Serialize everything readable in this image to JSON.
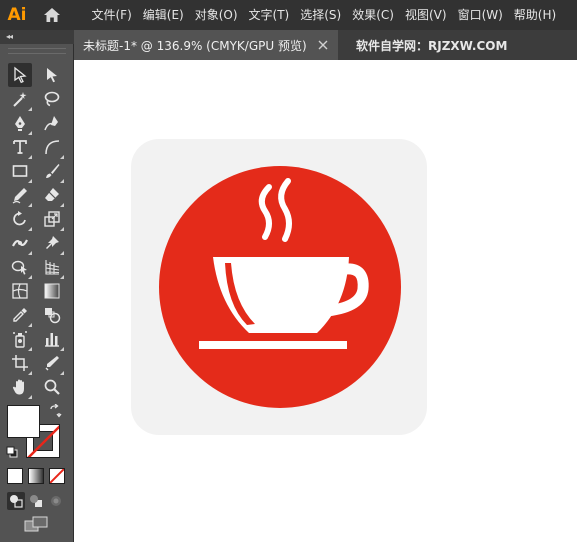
{
  "app": {
    "logo": "Ai",
    "home_icon": "home-icon"
  },
  "menu": {
    "items": [
      "文件(F)",
      "编辑(E)",
      "对象(O)",
      "文字(T)",
      "选择(S)",
      "效果(C)",
      "视图(V)",
      "窗口(W)",
      "帮助(H)"
    ]
  },
  "tabs": [
    {
      "label": "未标题-1* @ 136.9% (CMYK/GPU 预览)",
      "active": true
    },
    {
      "label": "软件自学网：RJZXW.COM",
      "active": false
    }
  ],
  "toolbar": {
    "collapse_glyph": "◂◂",
    "tools": [
      "selection-tool",
      "direct-selection-tool",
      "magic-wand-tool",
      "lasso-tool",
      "pen-tool",
      "curvature-tool",
      "type-tool",
      "line-segment-tool",
      "rectangle-tool",
      "paintbrush-tool",
      "shaper-tool",
      "eraser-tool",
      "rotate-tool",
      "scale-tool",
      "width-tool",
      "puppet-warp-tool",
      "shape-builder-tool",
      "perspective-grid-tool",
      "mesh-tool",
      "gradient-tool",
      "eyedropper-tool",
      "blend-tool",
      "symbol-sprayer-tool",
      "column-graph-tool",
      "artboard-tool",
      "slice-tool",
      "hand-tool",
      "zoom-tool"
    ],
    "selected_tool": "selection-tool"
  },
  "colors": {
    "menubar_bg": "#323232",
    "panel_bg": "#535353",
    "tab_inactive_bg": "#3c3c3c",
    "canvas_bg": "#ffffff",
    "icon_tile": "#f2f2f2",
    "circle_red": "#e42b1a",
    "cup_white": "#ffffff"
  },
  "artwork": {
    "description_icon": "coffee-cup-icon"
  }
}
